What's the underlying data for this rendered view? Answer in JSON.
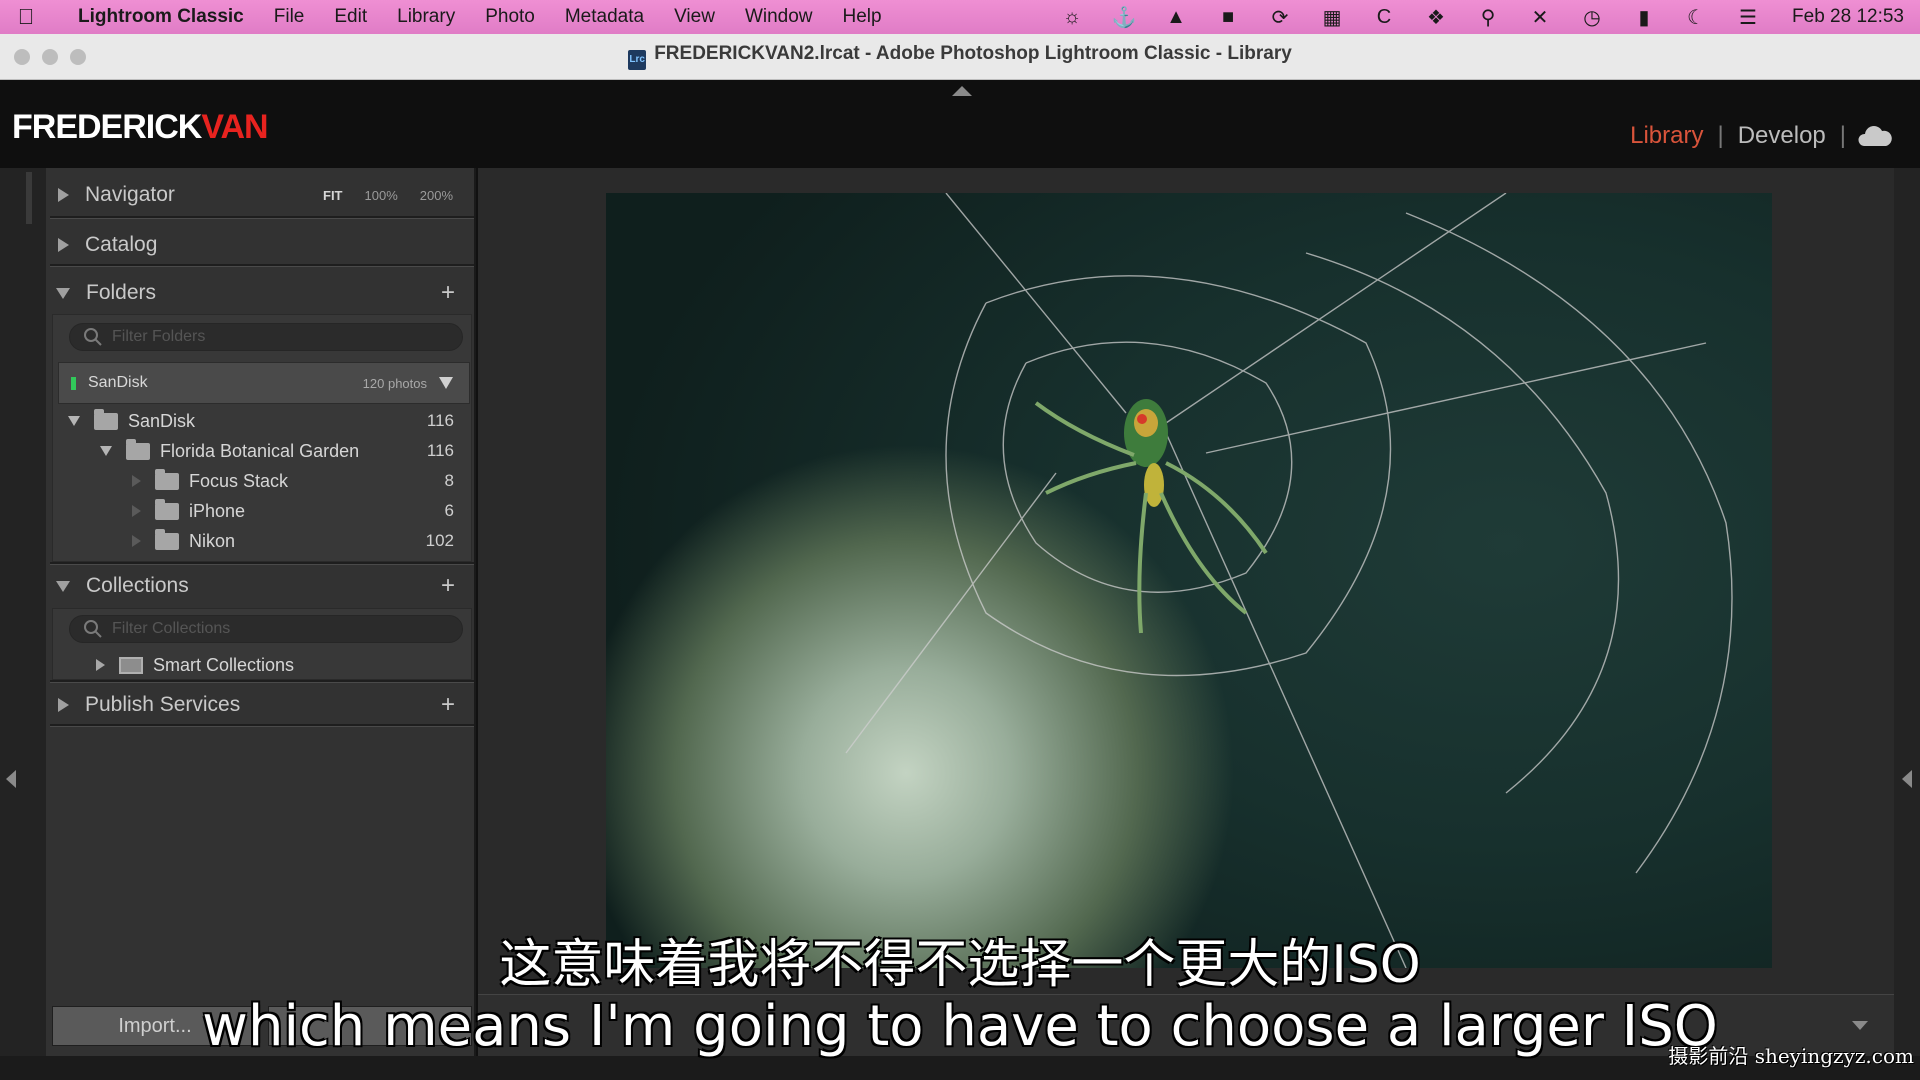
{
  "menubar": {
    "app": "Lightroom Classic",
    "items": [
      "File",
      "Edit",
      "Library",
      "Photo",
      "Metadata",
      "View",
      "Window",
      "Help"
    ],
    "status_icons": [
      "creative-cloud-icon",
      "anchor-icon",
      "drive-icon",
      "screen-icon",
      "refresh-icon",
      "keyboard-icon",
      "c-icon",
      "dropbox-icon",
      "search-icon",
      "mute-icon",
      "time-machine-icon",
      "battery-icon",
      "moon-icon",
      "control-center-icon"
    ],
    "clock": "Feb 28  12:53"
  },
  "window": {
    "title": "FREDERICKVAN2.lrcat - Adobe Photoshop Lightroom Classic - Library"
  },
  "identity": {
    "logo_white": "FREDERICK",
    "logo_red": "VAN",
    "modules": [
      "Library",
      "Develop"
    ],
    "active_module": "Library",
    "accent_color": "#d9543b"
  },
  "panels": {
    "navigator": {
      "label": "Navigator",
      "zoom": [
        "FIT",
        "100%",
        "200%"
      ]
    },
    "catalog": {
      "label": "Catalog"
    },
    "folders": {
      "label": "Folders",
      "filter_placeholder": "Filter Folders",
      "volume": {
        "name": "SanDisk",
        "count": "120 photos"
      },
      "tree": [
        {
          "name": "SanDisk",
          "count": "116"
        },
        {
          "name": "Florida Botanical Garden",
          "count": "116"
        },
        {
          "name": "Focus Stack",
          "count": "8"
        },
        {
          "name": "iPhone",
          "count": "6"
        },
        {
          "name": "Nikon",
          "count": "102"
        }
      ]
    },
    "collections": {
      "label": "Collections",
      "filter_placeholder": "Filter Collections",
      "items": [
        {
          "name": "Smart Collections"
        }
      ]
    },
    "publish": {
      "label": "Publish Services"
    },
    "import_label": "Import..."
  },
  "subtitles": {
    "chinese": "这意味着我将不得不选择一个更大的ISO",
    "english": "which means I'm going to have to choose a larger ISO"
  },
  "watermark": "摄影前沿 sheyingzyz.com"
}
